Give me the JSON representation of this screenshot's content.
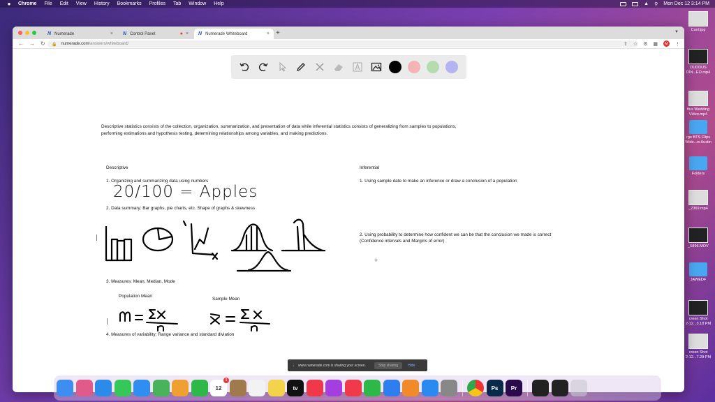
{
  "menubar": {
    "app": "Chrome",
    "items": [
      "File",
      "Edit",
      "View",
      "History",
      "Bookmarks",
      "Profiles",
      "Tab",
      "Window",
      "Help"
    ],
    "clock": "Mon Dec 12  3:14 PM"
  },
  "desktop": {
    "items": [
      {
        "label": "Card.jpg",
        "kind": "thumb"
      },
      {
        "label": "DUDDUS\nDIN...EO.mp4",
        "kind": "thumb-dark"
      },
      {
        "label": "ftus Wedding\nVideo.mp4",
        "kind": "thumb"
      },
      {
        "label": "rge BTS Clips\nWide...w Austin",
        "kind": "folder"
      },
      {
        "label": "Folders",
        "kind": "folder"
      },
      {
        "label": "_2369.mp4",
        "kind": "thumb"
      },
      {
        "label": "_5896.MOV",
        "kind": "thumb-dark"
      },
      {
        "label": "JAWEDF",
        "kind": "folder"
      },
      {
        "label": "creen Shot\n2-12...3.18 PM",
        "kind": "thumb-dark"
      },
      {
        "label": "creen Shot\n2-12...7.28 PM",
        "kind": "thumb"
      }
    ]
  },
  "browser": {
    "tabs": [
      {
        "title": "Numerade",
        "active": false
      },
      {
        "title": "Control Panel",
        "active": false
      },
      {
        "title": "Numerade Whiteboard",
        "active": true
      }
    ],
    "favicon": "N",
    "url_host": "numerade.com",
    "url_path": "/answers/whiteboard/",
    "profile_initial": "M"
  },
  "toolbar": {
    "tools": [
      "undo-icon",
      "redo-icon",
      "pointer-icon",
      "pen-icon",
      "tools-icon",
      "eraser-icon",
      "text-icon",
      "image-icon"
    ],
    "colors": [
      "#000000",
      "#f4b4b4",
      "#b4dcb0",
      "#b4b4f0"
    ]
  },
  "notes": {
    "intro": "Descriptive statistics consists of the collection, organization, summarization, and presentation of data while inferential statistics consists of generalizing from samples to populations, performing estimations and hypothesis testing, determining relationships among variables, and making predictions.",
    "descriptive_heading": "Descriptive",
    "inferential_heading": "Inferential",
    "d1": "1. Organizing and summarizing data using numbers",
    "hand_apples": "20/100 = Apples",
    "d2": "2. Data summary: Bar graphs, pie charts, etc. Shape of graphs & skewness",
    "d3": "3. Measures: Mean, Median, Mode",
    "population_mean": "Population Mean",
    "sample_mean": "Sample Mean",
    "d4": "4. Measures of variability: Range variance and standard diviation",
    "i1": "1. Using sample date to make an inference or draw a conclusion of a population",
    "i2": "2. Using probability to determine how confident we can be that the conclusion we made is correct",
    "i2b": "(Confidence intervals and Margins of error)"
  },
  "share_notice": {
    "text": "www.numerade.com is sharing your screen.",
    "stop": "Stop sharing",
    "hide": "Hide"
  },
  "dock": {
    "apps": [
      {
        "name": "finder-icon",
        "color": "#3d8ef0",
        "glyph": ""
      },
      {
        "name": "launchpad-icon",
        "color": "#e05a8a",
        "glyph": ""
      },
      {
        "name": "safari-icon",
        "color": "#2a8be8",
        "glyph": ""
      },
      {
        "name": "messages-icon",
        "color": "#35c759",
        "glyph": ""
      },
      {
        "name": "mail-icon",
        "color": "#2f8ff0",
        "glyph": ""
      },
      {
        "name": "maps-icon",
        "color": "#49b35b",
        "glyph": ""
      },
      {
        "name": "photos-icon",
        "color": "#f0a030",
        "glyph": ""
      },
      {
        "name": "facetime-icon",
        "color": "#2fb84a",
        "glyph": ""
      },
      {
        "name": "calendar-icon",
        "color": "#ffffff",
        "glyph": "12"
      },
      {
        "name": "notes-icon",
        "color": "#a07a4a",
        "glyph": ""
      },
      {
        "name": "reminders-icon",
        "color": "#f2f2f2",
        "glyph": ""
      },
      {
        "name": "stickies-icon",
        "color": "#f3d34a",
        "glyph": ""
      },
      {
        "name": "tv-icon",
        "color": "#111111",
        "glyph": "tv"
      },
      {
        "name": "music-icon",
        "color": "#f0384a",
        "glyph": ""
      },
      {
        "name": "podcasts-icon",
        "color": "#a43ee0",
        "glyph": ""
      },
      {
        "name": "news-icon",
        "color": "#f03a4a",
        "glyph": ""
      },
      {
        "name": "numbers-icon",
        "color": "#2fb84a",
        "glyph": ""
      },
      {
        "name": "keynote-icon",
        "color": "#2f7ef0",
        "glyph": ""
      },
      {
        "name": "pages-icon",
        "color": "#f08a2a",
        "glyph": ""
      },
      {
        "name": "app-store-icon",
        "color": "#2a8af0",
        "glyph": ""
      },
      {
        "name": "system-settings-icon",
        "color": "#888888",
        "glyph": ""
      },
      {
        "name": "chrome-icon",
        "color": "#ffffff",
        "glyph": ""
      },
      {
        "name": "photoshop-icon",
        "color": "#0a2a4a",
        "glyph": "Ps"
      },
      {
        "name": "premiere-icon",
        "color": "#2a0a4a",
        "glyph": "Pr"
      }
    ],
    "calendar_badge": "1"
  }
}
